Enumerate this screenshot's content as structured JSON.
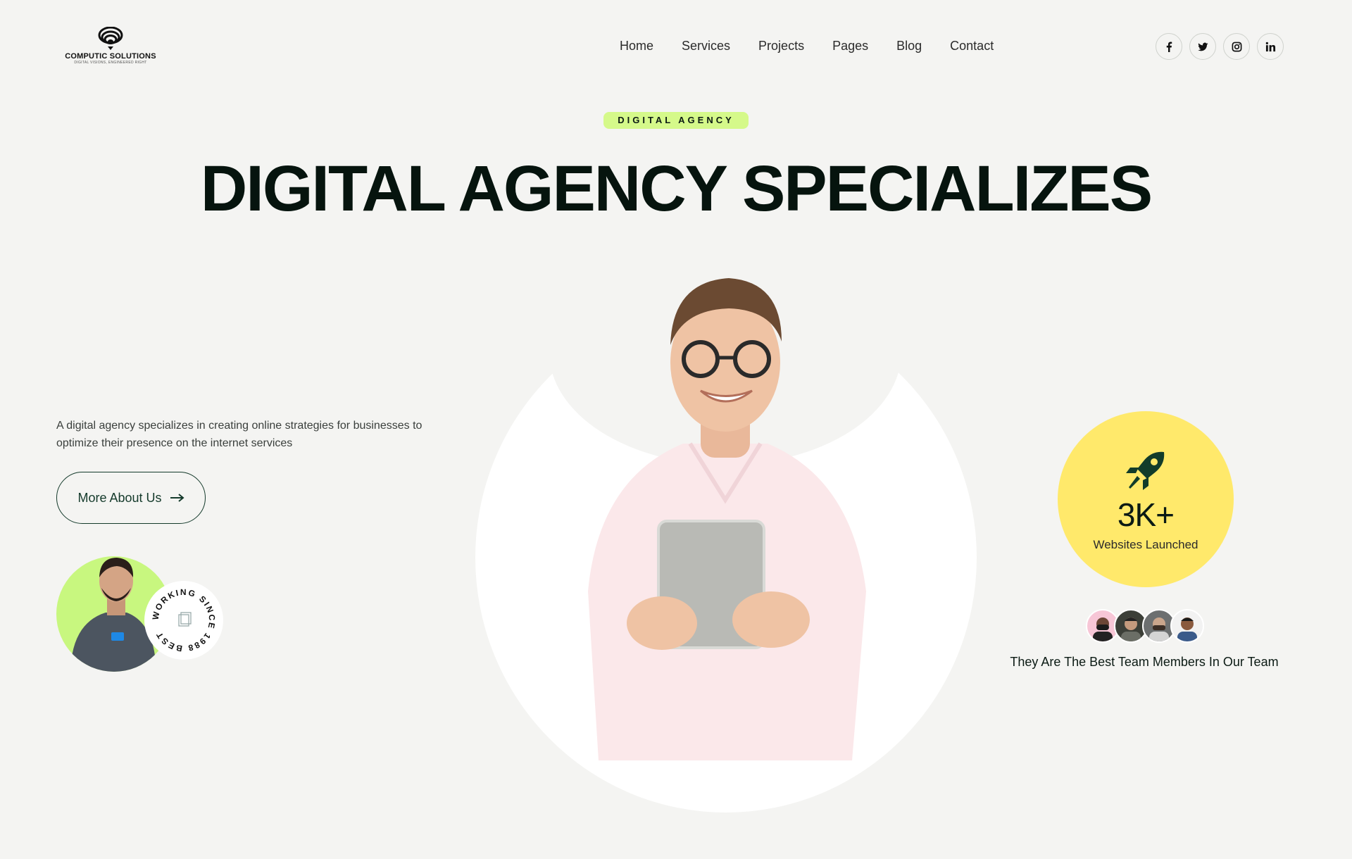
{
  "brand": {
    "name": "COMPUTIC SOLUTIONS",
    "tagline": "DIGITAL VISIONS, ENGINEERED RIGHT"
  },
  "nav": {
    "items": [
      {
        "label": "Home"
      },
      {
        "label": "Services"
      },
      {
        "label": "Projects"
      },
      {
        "label": "Pages"
      },
      {
        "label": "Blog"
      },
      {
        "label": "Contact"
      }
    ]
  },
  "socials": [
    "facebook-icon",
    "twitter-icon",
    "instagram-icon",
    "linkedin-icon"
  ],
  "hero": {
    "badge": "DIGITAL AGENCY",
    "title": "DIGITAL AGENCY SPECIALIZES",
    "description": "A digital agency specializes in creating online strategies for businesses to optimize their presence on the internet services",
    "cta_label": "More About Us"
  },
  "since_badge": {
    "ring_text": "WORKING SINCE 1988 BEST "
  },
  "stat": {
    "value": "3K+",
    "label": "Websites Launched",
    "icon": "rocket-icon"
  },
  "team": {
    "caption": "They Are The Best Team Members In Our Team",
    "avatar_count": 4
  },
  "colors": {
    "background": "#f4f4f2",
    "badge_green": "#d5f98a",
    "lime_circle": "#c8f77f",
    "stat_yellow": "#ffe96b",
    "dark_green": "#143a2b"
  }
}
